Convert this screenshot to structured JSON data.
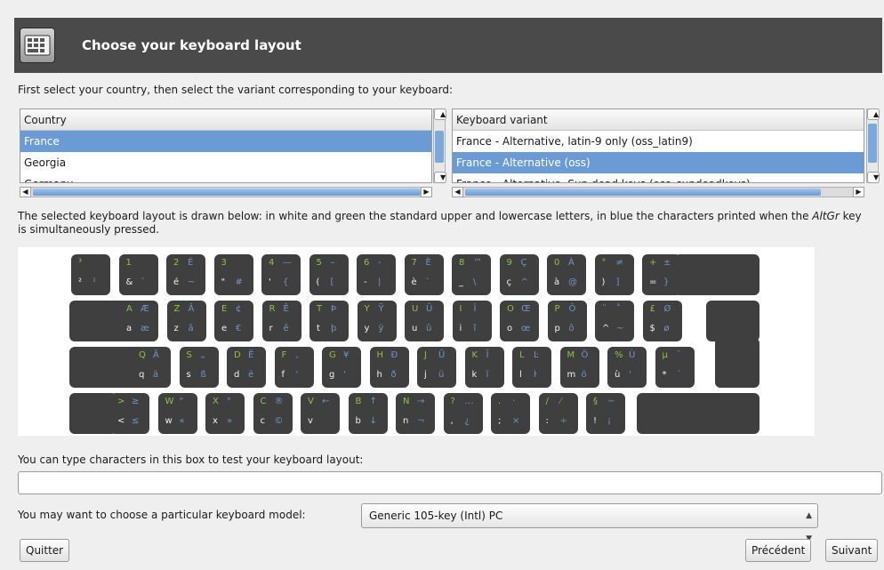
{
  "header": {
    "title": "Choose your keyboard layout",
    "icon": "keyboard-icon"
  },
  "instructions": "First select your country, then select the variant corresponding to your keyboard:",
  "country_list": {
    "header": "Country",
    "rows": [
      "France",
      "Georgia",
      "Germany"
    ],
    "selected": "France"
  },
  "variant_list": {
    "header": "Keyboard variant",
    "rows": [
      "France - Alternative, latin-9 only (oss_latin9)",
      "France - Alternative (oss)",
      "France - Alternative, Sun dead keys (oss_sundeadkeys)"
    ],
    "selected": "France - Alternative (oss)"
  },
  "description_part1": "The selected keyboard layout is drawn below: in white and green the standard upper and lowercase letters, in blue the characters printed when the ",
  "description_altgr": "AltGr",
  "description_part2": " key is simultaneously pressed.",
  "keyboard": {
    "colors": {
      "green": "#8ec43d",
      "blue": "#6e95c9",
      "white": "#f2f2f2",
      "key": "#3f3f3f"
    },
    "rows": [
      [
        [
          "³",
          "",
          "²",
          "¹"
        ],
        [
          "1",
          "",
          "&",
          "´"
        ],
        [
          "2",
          "É",
          "é",
          "~"
        ],
        [
          "3",
          "",
          "\"",
          "#"
        ],
        [
          "4",
          "—",
          "'",
          "{"
        ],
        [
          "5",
          "–",
          "(",
          "["
        ],
        [
          "6",
          "‑",
          "-",
          "|"
        ],
        [
          "7",
          "È",
          "è",
          "`"
        ],
        [
          "8",
          "™",
          "_",
          "\\"
        ],
        [
          "9",
          "Ç",
          "ç",
          "^"
        ],
        [
          "0",
          "À",
          "à",
          "@"
        ],
        [
          "°",
          "≠",
          ")",
          "]"
        ],
        [
          "+",
          "±",
          "=",
          "}"
        ]
      ],
      [
        [
          "A",
          "Æ",
          "a",
          "æ"
        ],
        [
          "Z",
          "Â",
          "z",
          "â"
        ],
        [
          "E",
          "¢",
          "e",
          "€"
        ],
        [
          "R",
          "Ê",
          "r",
          "ê"
        ],
        [
          "T",
          "Þ",
          "t",
          "þ"
        ],
        [
          "Y",
          "Ÿ",
          "y",
          "ÿ"
        ],
        [
          "U",
          "Û",
          "u",
          "û"
        ],
        [
          "I",
          "Î",
          "i",
          "î"
        ],
        [
          "O",
          "Œ",
          "o",
          "œ"
        ],
        [
          "P",
          "Ô",
          "p",
          "ô"
        ],
        [
          "¨",
          "˚",
          "^",
          "~"
        ],
        [
          "£",
          "Ø",
          "$",
          "ø"
        ]
      ],
      [
        [
          "Q",
          "Ä",
          "q",
          "ä"
        ],
        [
          "S",
          "„",
          "s",
          "ß"
        ],
        [
          "D",
          "Ë",
          "d",
          "ë"
        ],
        [
          "F",
          "‚",
          "f",
          "'"
        ],
        [
          "G",
          "¥",
          "g",
          "'"
        ],
        [
          "H",
          "Ð",
          "h",
          "ð"
        ],
        [
          "J",
          "Ü",
          "j",
          "ü"
        ],
        [
          "K",
          "Ï",
          "k",
          "ï"
        ],
        [
          "L",
          "Ŀ",
          "l",
          "ŀ"
        ],
        [
          "M",
          "Ö",
          "m",
          "ö"
        ],
        [
          "%",
          "Ù",
          "ù",
          "'"
        ],
        [
          "µ",
          "¯",
          "*",
          "´"
        ]
      ],
      [
        [
          ">",
          "≥",
          "<",
          "≤"
        ],
        [
          "W",
          "\"",
          "w",
          "«"
        ],
        [
          "X",
          "\"",
          "x",
          "»"
        ],
        [
          "C",
          "®",
          "c",
          "©"
        ],
        [
          "V",
          "←",
          "v",
          " "
        ],
        [
          "B",
          "↑",
          "b",
          "↓"
        ],
        [
          "N",
          "→",
          "n",
          "¬"
        ],
        [
          "?",
          "…",
          ",",
          "¿"
        ],
        [
          ".",
          "·",
          ";",
          "×"
        ],
        [
          "/",
          "⁄",
          ":",
          "÷"
        ],
        [
          "§",
          "−",
          "!",
          "¡"
        ]
      ]
    ]
  },
  "test_label": "You can type characters in this box to test your keyboard layout:",
  "test_input_value": "",
  "model_label": "You may want to choose a particular keyboard model:",
  "model_value": "Generic 105-key (Intl) PC",
  "buttons": {
    "quit": "Quitter",
    "previous": "Précédent",
    "next": "Suivant"
  }
}
